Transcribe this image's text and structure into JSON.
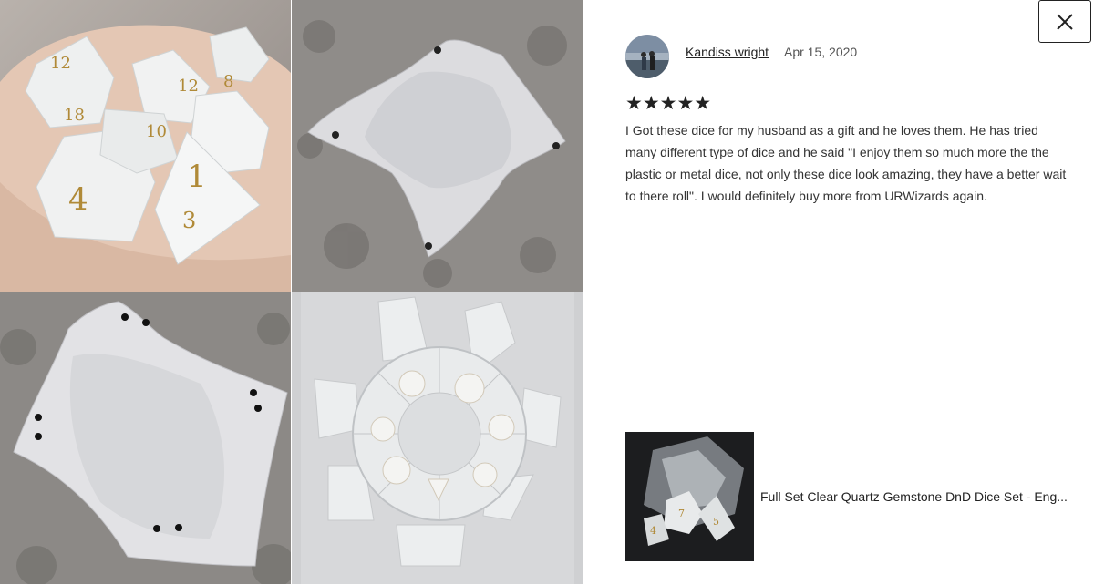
{
  "review": {
    "reviewer_name": "Kandiss wright",
    "date": "Apr 15, 2020",
    "rating": 5,
    "stars_text": "★★★★★",
    "text": "I Got these dice for my husband as a gift and he loves them. He has tried many different type of dice and he said \"I enjoy them so much more the the plastic or metal dice, not only these dice look amazing, they have a better wait to there roll\". I would definitely buy more from URWizards again."
  },
  "product": {
    "title": "Full Set Clear Quartz Gemstone DnD Dice Set - Eng..."
  },
  "gallery": {
    "photos": [
      "dice-in-hand-photo",
      "folded-dice-tray-photo",
      "flat-dice-tray-photo",
      "dice-case-photo"
    ]
  },
  "icons": {
    "close": "close-icon"
  },
  "colors": {
    "text": "#333333",
    "stars": "#222222",
    "border": "#222222"
  }
}
